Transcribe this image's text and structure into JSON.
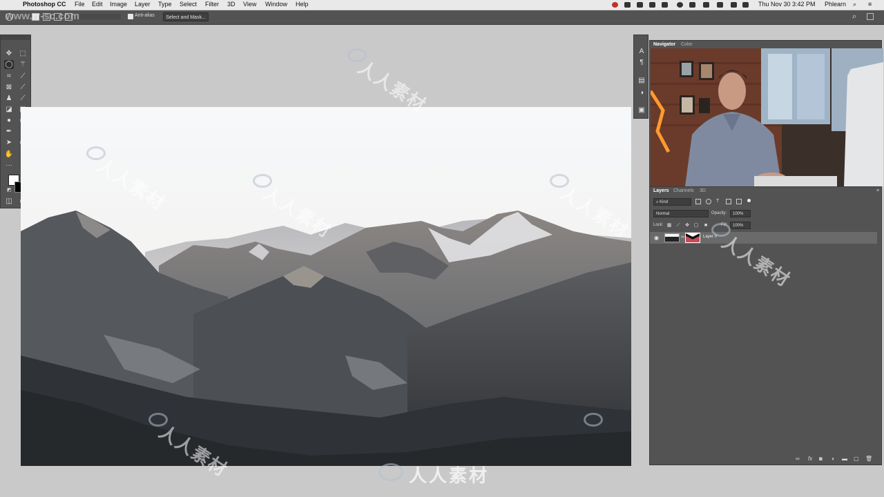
{
  "menubar": {
    "app_name": "Photoshop CC",
    "items": [
      "File",
      "Edit",
      "Image",
      "Layer",
      "Type",
      "Select",
      "Filter",
      "3D",
      "View",
      "Window",
      "Help"
    ],
    "datetime": "Thu Nov 30  3:42 PM",
    "user": "Phlearn"
  },
  "options": {
    "anti_alias_label": "Anti-alias",
    "anti_alias_checked": true,
    "select_and_mask_label": "Select and Mask..."
  },
  "toolbar": {
    "active_tool": "lasso-icon",
    "tools": [
      "move-icon",
      "marquee-icon",
      "lasso-icon",
      "magic-wand-icon",
      "crop-icon",
      "eyedropper-icon",
      "frame-icon",
      "brush-icon",
      "stamp-icon",
      "history-brush-icon",
      "eraser-icon",
      "gradient-icon",
      "blur-icon",
      "dodge-icon",
      "pen-icon",
      "type-icon",
      "path-select-icon",
      "shape-icon",
      "hand-icon",
      "zoom-icon",
      "more-tools-icon"
    ],
    "foreground_color": "#ffffff",
    "background_color": "#000000"
  },
  "navigator_panel": {
    "tabs": [
      "Navigator",
      "Color"
    ]
  },
  "layers_panel": {
    "tabs": [
      "Layers",
      "Channels",
      "3D"
    ],
    "filter_kind": "Kind",
    "blend_mode": "Normal",
    "opacity_label": "Opacity:",
    "opacity_value": "100%",
    "lock_label": "Lock:",
    "fill_label": "Fill:",
    "fill_value": "100%",
    "layers": [
      {
        "name": "Layer 0",
        "visible": true,
        "has_mask": true
      }
    ]
  },
  "watermark": {
    "text": "人人素材",
    "corner_text": "www.rr-sc.com"
  },
  "colors": {
    "ui_dark": "#535353",
    "ui_darker": "#3c3c3c",
    "pasteboard": "#c9c9c9",
    "selected_layer": "#6a6a6a"
  }
}
